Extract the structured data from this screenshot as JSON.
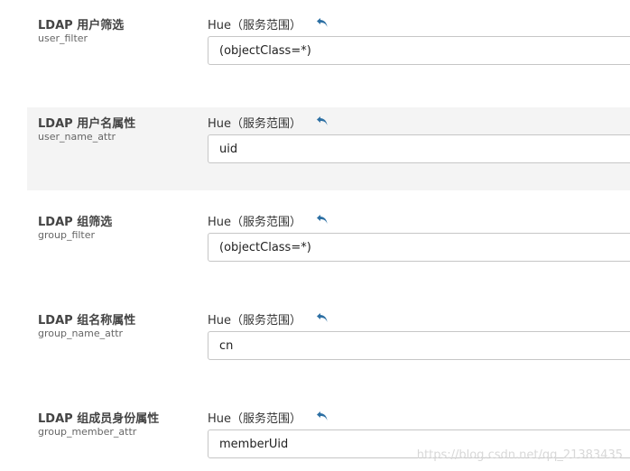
{
  "properties": [
    {
      "label": "LDAP 用户筛选",
      "key": "user_filter",
      "scope": "Hue（服务范围）",
      "undo_icon": "undo-arrow-icon",
      "value": "(objectClass=*)"
    },
    {
      "label": "LDAP 用户名属性",
      "key": "user_name_attr",
      "scope": "Hue（服务范围）",
      "undo_icon": "undo-arrow-icon",
      "value": "uid"
    },
    {
      "label": "LDAP 组筛选",
      "key": "group_filter",
      "scope": "Hue（服务范围）",
      "undo_icon": "undo-arrow-icon",
      "value": "(objectClass=*)"
    },
    {
      "label": "LDAP 组名称属性",
      "key": "group_name_attr",
      "scope": "Hue（服务范围）",
      "undo_icon": "undo-arrow-icon",
      "value": "cn"
    },
    {
      "label": "LDAP 组成员身份属性",
      "key": "group_member_attr",
      "scope": "Hue（服务范围）",
      "undo_icon": "undo-arrow-icon",
      "value": "memberUid"
    }
  ],
  "colors": {
    "accent": "#2c6fa3",
    "shaded_row": "#f4f4f4",
    "input_border": "#c6c6c6"
  },
  "watermark": "https://blog.csdn.net/qq_21383435"
}
